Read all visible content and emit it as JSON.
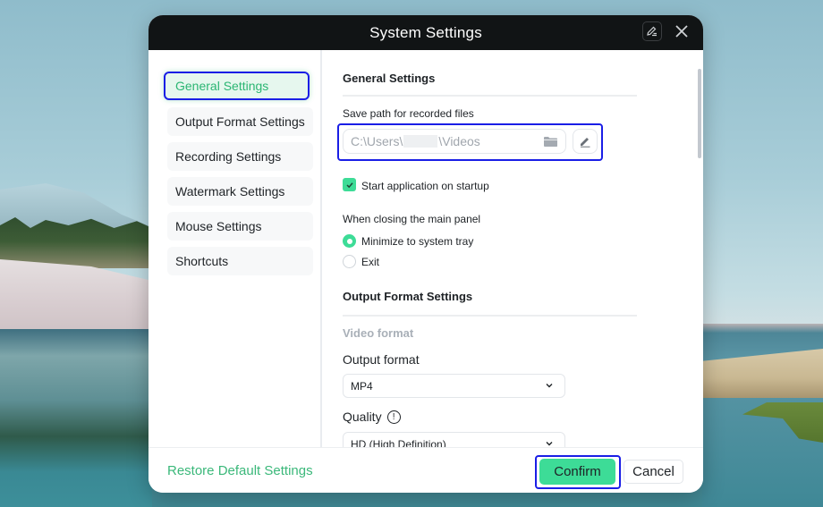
{
  "dialog": {
    "title": "System Settings",
    "title_icons": [
      "edit-note-icon",
      "close-icon"
    ]
  },
  "sidebar": {
    "items": [
      {
        "label": "General Settings",
        "active": true
      },
      {
        "label": "Output Format Settings",
        "active": false
      },
      {
        "label": "Recording Settings",
        "active": false
      },
      {
        "label": "Watermark Settings",
        "active": false
      },
      {
        "label": "Mouse Settings",
        "active": false
      },
      {
        "label": "Shortcuts",
        "active": false
      }
    ]
  },
  "general": {
    "heading": "General Settings",
    "save_path_label": "Save path for recorded files",
    "save_path_prefix": "C:\\Users\\",
    "save_path_suffix": "\\Videos",
    "startup_label": "Start application on startup",
    "startup_checked": true,
    "closing_label": "When closing the main panel",
    "closing_options": [
      {
        "label": "Minimize to system tray",
        "selected": true
      },
      {
        "label": "Exit",
        "selected": false
      }
    ]
  },
  "output": {
    "heading": "Output Format Settings",
    "video_format_subhead": "Video format",
    "output_format_label": "Output format",
    "output_format_value": "MP4",
    "quality_label": "Quality",
    "quality_value": "HD (High Definition)"
  },
  "footer": {
    "restore_label": "Restore Default Settings",
    "confirm_label": "Confirm",
    "cancel_label": "Cancel"
  },
  "colors": {
    "accent": "#3ddc97",
    "accent_text": "#3bb87a",
    "titlebar": "#111415",
    "highlight_border": "#1a1ee6"
  }
}
